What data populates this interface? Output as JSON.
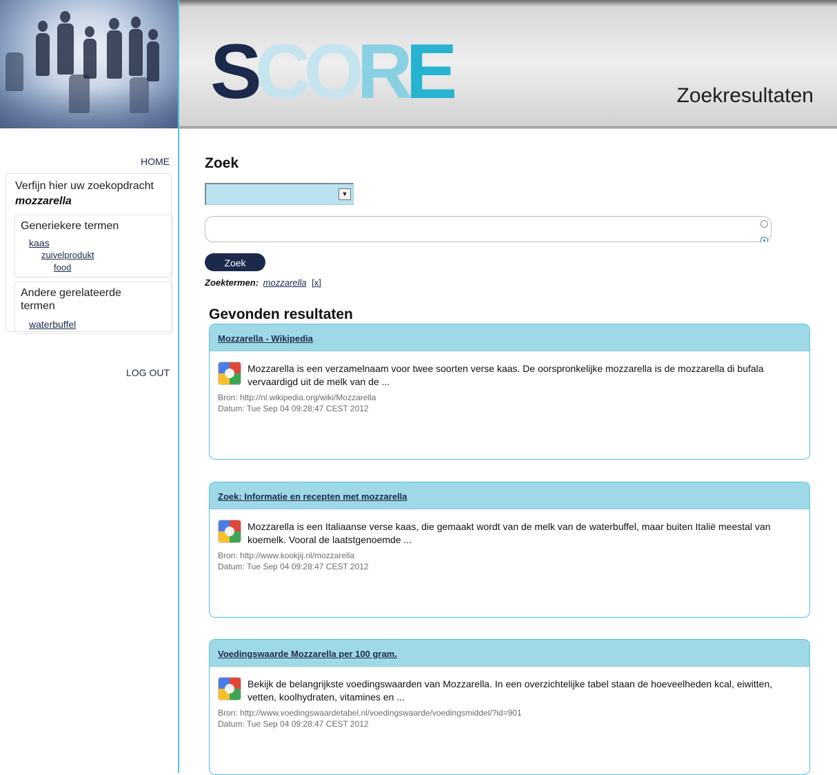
{
  "header": {
    "logo_text": [
      "S",
      "C",
      "O",
      "R",
      "E"
    ],
    "page_title": "Zoekresultaten",
    "brand_colors": {
      "navy": "#1b2a4b",
      "light_blue": "#c6e4ef",
      "mid_blue": "#8ad0e3",
      "cyan": "#25b3d0"
    }
  },
  "sidebar": {
    "home_label": "HOME",
    "logout_label": "LOG OUT",
    "refine_title": "Verfijn hier uw zoekopdracht",
    "refine_term": "mozzarella",
    "generic_section": {
      "title": "Generiekere termen",
      "items": [
        {
          "label": "kaas",
          "level": 1
        },
        {
          "label": "zuivelprodukt",
          "level": 2
        },
        {
          "label": "food",
          "level": 3
        }
      ]
    },
    "related_section": {
      "title_line1": "Andere gerelateerde",
      "title_line2": "termen",
      "items": [
        {
          "label": "waterbuffel"
        }
      ]
    }
  },
  "search": {
    "heading": "Zoek",
    "select_value": "",
    "input_value": "",
    "button_label": "Zoek",
    "terms_label": "Zoektermen:",
    "active_term": "mozzarella",
    "remove_label": "[x]"
  },
  "results": {
    "heading": "Gevonden resultaten",
    "items": [
      {
        "title": "Mozzarella - Wikipedia",
        "snippet": "Mozzarella is een verzamelnaam voor twee soorten verse kaas. De oorspronkelijke mozzarella is de mozzarella di bufala vervaardigd uit de melk van de ...",
        "source": "Bron: http://nl.wikipedia.org/wiki/Mozzarella",
        "date": "Datum: Tue Sep 04 09:28:47 CEST 2012",
        "icon": "google-icon"
      },
      {
        "title": "Zoek: Informatie en recepten met mozzarella",
        "snippet": "Mozzarella is een Italiaanse verse kaas, die gemaakt wordt van de melk van de waterbuffel, maar buiten Italië meestal van koemelk. Vooral de laatstgenoemde ...",
        "source": "Bron: http://www.kookjij.nl/mozzarella",
        "date": "Datum: Tue Sep 04 09:28:47 CEST 2012",
        "icon": "google-icon"
      },
      {
        "title": "Voedingswaarde Mozzarella per 100 gram.",
        "snippet": "Bekijk de belangrijkste voedingswaarden van Mozzarella. In een overzichtelijke tabel staan de hoeveelheden kcal, eiwitten, vetten, koolhydraten, vitamines en ...",
        "source": "Bron: http://www.voedingswaardetabel.nl/voedingswaarde/voedingsmiddel/?id=901",
        "date": "Datum: Tue Sep 04 09:28:47 CEST 2012",
        "icon": "google-icon"
      }
    ]
  }
}
